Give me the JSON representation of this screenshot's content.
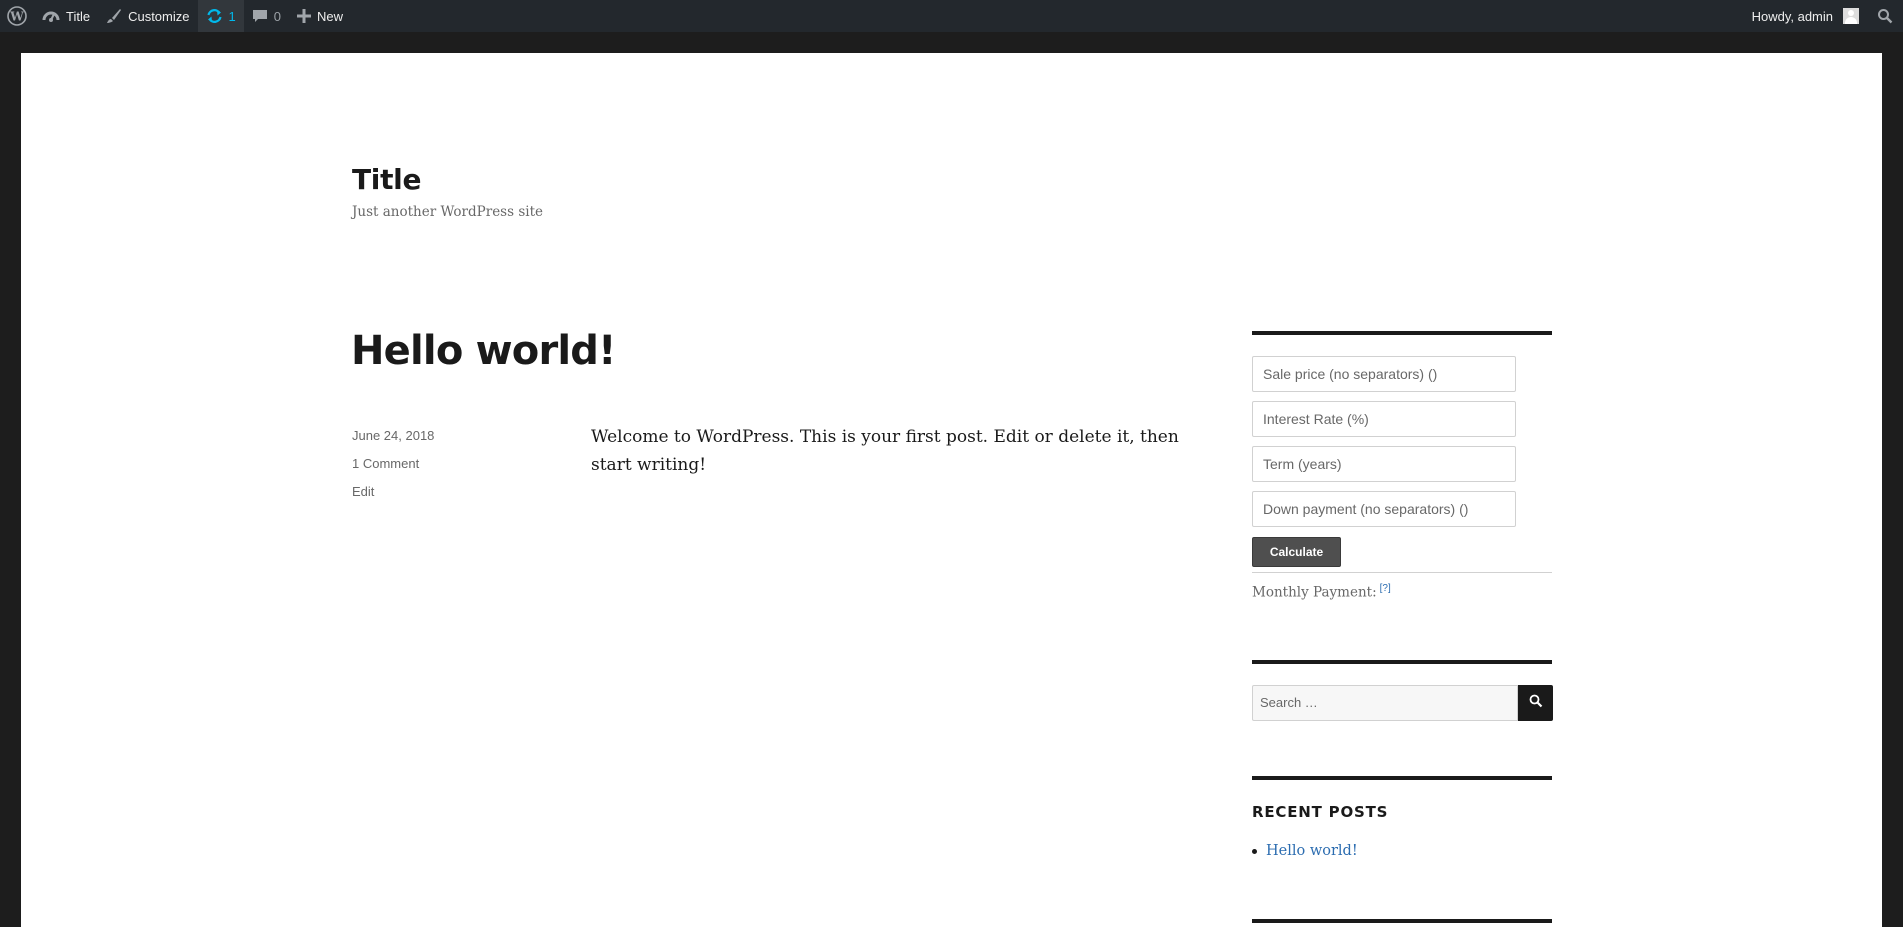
{
  "adminbar": {
    "site_name": "Title",
    "customize_label": "Customize",
    "updates_count": "1",
    "comments_count": "0",
    "new_label": "New",
    "howdy": "Howdy, admin"
  },
  "site": {
    "title": "Title",
    "description": "Just another WordPress site"
  },
  "post": {
    "title": "Hello world!",
    "date": "June 24, 2018",
    "comments_link": "1 Comment",
    "edit_link": "Edit",
    "content": "Welcome to WordPress. This is your first post. Edit or delete it, then start writing!"
  },
  "calculator": {
    "sale_price_placeholder": "Sale price (no separators) ()",
    "interest_rate_placeholder": "Interest Rate (%)",
    "term_placeholder": "Term (years)",
    "down_payment_placeholder": "Down payment (no separators) ()",
    "calculate_label": "Calculate",
    "monthly_payment_label": "Monthly Payment:",
    "help_marker": "[?]"
  },
  "search": {
    "placeholder": "Search …"
  },
  "recent_posts": {
    "heading": "RECENT POSTS",
    "items": [
      "Hello world!"
    ]
  },
  "colors": {
    "admin_bar": "#23282d",
    "updates_accent": "#00b9eb",
    "link": "#2b6cb0",
    "text": "#1a1a1a"
  }
}
